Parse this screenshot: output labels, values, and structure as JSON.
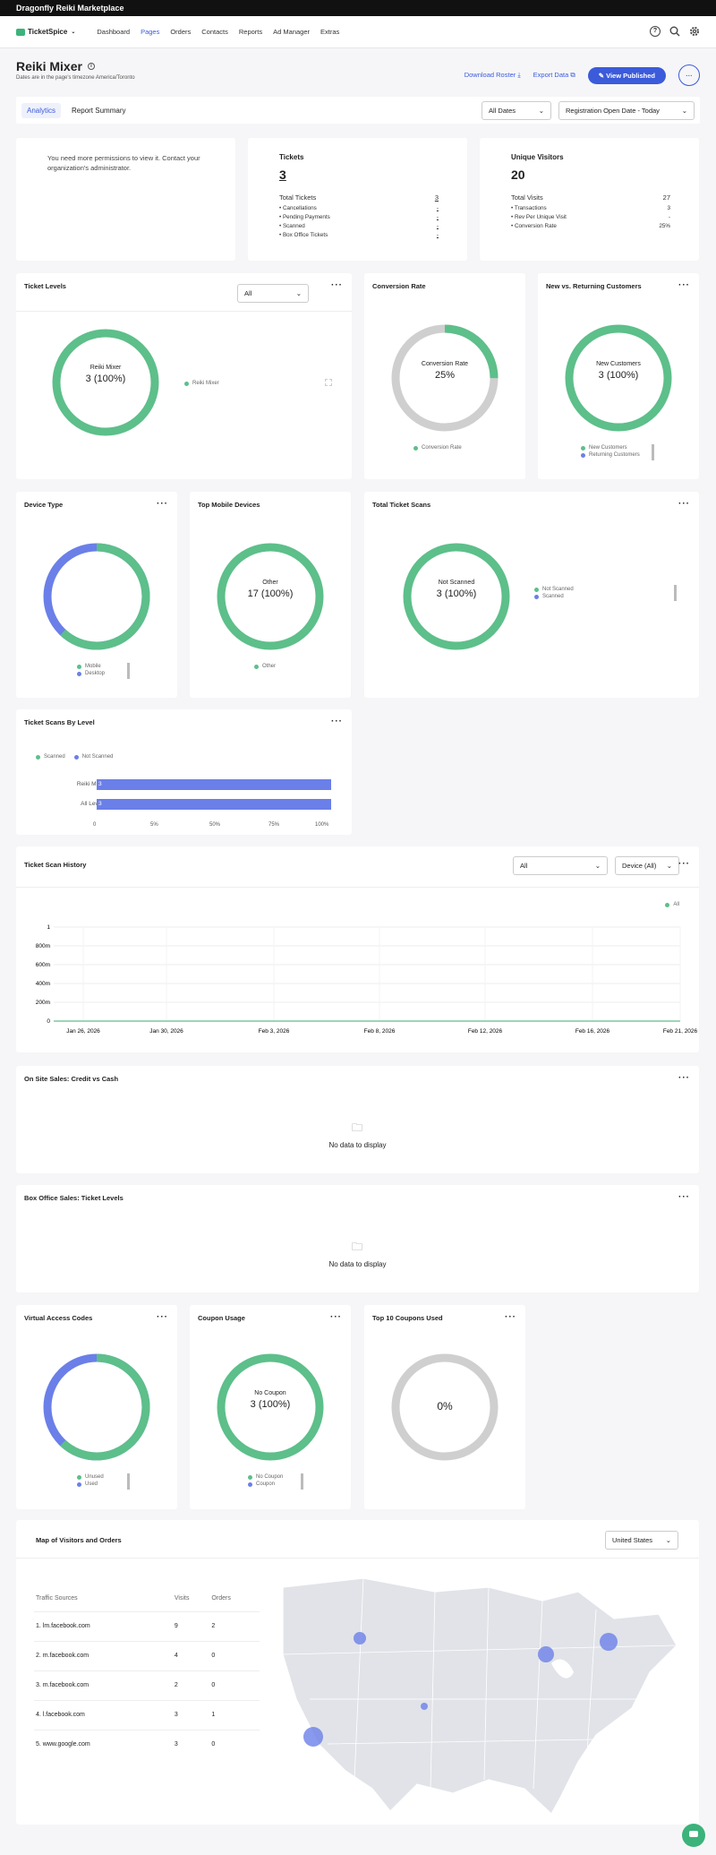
{
  "app": {
    "title": "Dragonfly Reiki Marketplace",
    "logo": "TicketSpice"
  },
  "nav": {
    "items": [
      "Dashboard",
      "Pages",
      "Orders",
      "Contacts",
      "Reports",
      "Ad Manager",
      "Extras"
    ],
    "active": "Pages"
  },
  "page": {
    "title": "Reiki Mixer",
    "timezone": "Dates are in the page's timezone America/Toronto",
    "download_roster": "Download Roster",
    "export_data": "Export Data",
    "view_published": "View Published"
  },
  "tabs": {
    "analytics": "Analytics",
    "report_summary": "Report Summary",
    "date_filter": "All Dates",
    "date_sort": "Registration Open Date - Today"
  },
  "permissions": {
    "message": "You need more permissions to view it. Contact your organization's administrator."
  },
  "tickets": {
    "title": "Tickets",
    "value": "3",
    "rows": [
      {
        "label": "Total Tickets",
        "value": "3"
      },
      {
        "label": "Cancellations",
        "value": "-"
      },
      {
        "label": "Pending Payments",
        "value": "-"
      },
      {
        "label": "Scanned",
        "value": "-"
      },
      {
        "label": "Box Office Tickets",
        "value": "-"
      }
    ]
  },
  "visitors": {
    "title": "Unique Visitors",
    "value": "20",
    "rows": [
      {
        "label": "Total Visits",
        "value": "27"
      },
      {
        "label": "Transactions",
        "value": "3"
      },
      {
        "label": "Rev Per Unique Visit",
        "value": "-"
      },
      {
        "label": "Conversion Rate",
        "value": "25%"
      }
    ]
  },
  "ticket_levels": {
    "title": "Ticket Levels",
    "filter": "All",
    "center_label": "Reiki Mixer",
    "center_value": "3 (100%)",
    "legend": "Reiki Mixer"
  },
  "conversion": {
    "title": "Conversion Rate",
    "center_label": "Conversion Rate",
    "center_value": "25%",
    "legend": "Conversion Rate",
    "fraction": 0.25
  },
  "new_returning": {
    "title": "New vs. Returning Customers",
    "center_label": "New Customers",
    "center_value": "3 (100%)",
    "legend": [
      "New Customers",
      "Returning Customers"
    ]
  },
  "device_type": {
    "title": "Device Type",
    "legend": [
      "Mobile",
      "Desktop"
    ],
    "mobile_fraction": 0.62
  },
  "mobile_devices": {
    "title": "Top Mobile Devices",
    "center_label": "Other",
    "center_value": "17 (100%)",
    "legend": "Other"
  },
  "total_scans": {
    "title": "Total Ticket Scans",
    "center_label": "Not Scanned",
    "center_value": "3 (100%)",
    "legend": [
      "Not Scanned",
      "Scanned"
    ]
  },
  "scans_by_level": {
    "title": "Ticket Scans By Level",
    "legend": [
      "Scanned",
      "Not Scanned"
    ],
    "rows": [
      {
        "label": "Reiki Mixer",
        "value": "3"
      },
      {
        "label": "All Levels",
        "value": "3"
      }
    ],
    "ticks": [
      "0",
      "5%",
      "50%",
      "75%",
      "100%"
    ]
  },
  "scan_history": {
    "title": "Ticket Scan History",
    "filter1": "All",
    "filter2": "Device (All)",
    "legend": "All",
    "y_ticks": [
      "1",
      "800m",
      "600m",
      "400m",
      "200m",
      "0"
    ],
    "x_ticks": [
      "Jan 26, 2026",
      "Jan 30, 2026",
      "Feb 3, 2026",
      "Feb 8, 2026",
      "Feb 12, 2026",
      "Feb 16, 2026",
      "Feb 21, 2026"
    ]
  },
  "onsite_sales": {
    "title": "On Site Sales: Credit vs Cash",
    "empty": "No data to display"
  },
  "box_office": {
    "title": "Box Office Sales: Ticket Levels",
    "empty": "No data to display"
  },
  "virtual_codes": {
    "title": "Virtual Access Codes",
    "legend": [
      "Unused",
      "Used"
    ],
    "unused_fraction": 0.62
  },
  "coupon_usage": {
    "title": "Coupon Usage",
    "center_label": "No Coupon",
    "center_value": "3 (100%)",
    "legend": [
      "No Coupon",
      "Coupon"
    ]
  },
  "top_coupons": {
    "title": "Top 10 Coupons Used",
    "center_value": "0%"
  },
  "map": {
    "title": "Map of Visitors and Orders",
    "country": "United States",
    "headers": [
      "Traffic Sources",
      "Visits",
      "Orders"
    ],
    "rows": [
      {
        "source": "1. lm.facebook.com",
        "visits": "9",
        "orders": "2"
      },
      {
        "source": "2. m.facebook.com",
        "visits": "4",
        "orders": "0"
      },
      {
        "source": "3. m.facebook.com",
        "visits": "2",
        "orders": "0"
      },
      {
        "source": "4. l.facebook.com",
        "visits": "3",
        "orders": "1"
      },
      {
        "source": "5. www.google.com",
        "visits": "3",
        "orders": "0"
      }
    ]
  },
  "colors": {
    "green": "#5dbf8a",
    "blue": "#6b7fe8",
    "gray": "#cfcfcf",
    "accent": "#3b5bdb"
  }
}
